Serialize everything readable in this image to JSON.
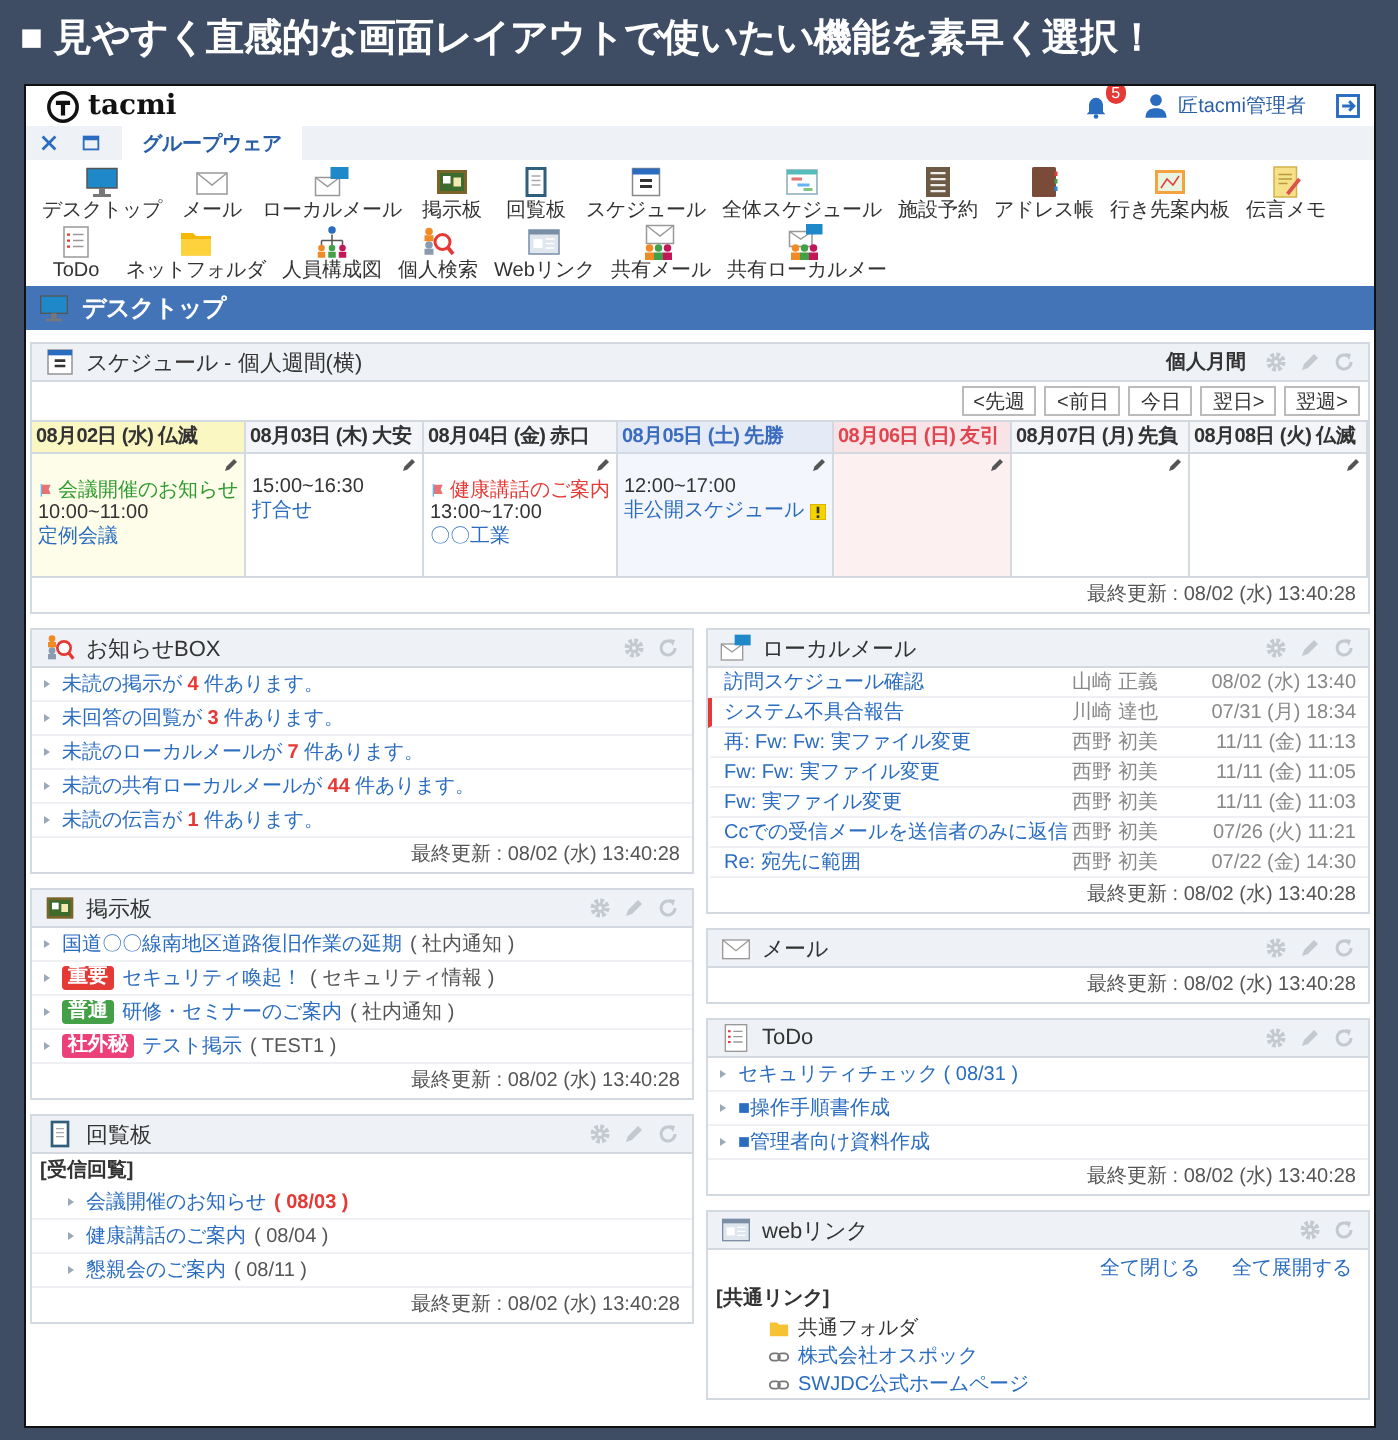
{
  "banner": {
    "title": "■ 見やすく直感的な画面レイアウトで使いたい機能を素早く選択！"
  },
  "header": {
    "logo": "tacmi",
    "notifications": "5",
    "user": "匠tacmi管理者"
  },
  "tabs": [
    {
      "label": "グループウェア",
      "selected": true
    }
  ],
  "apps": [
    {
      "label": "デスクトップ",
      "kind": "monitor"
    },
    {
      "label": "メール",
      "kind": "mail"
    },
    {
      "label": "ローカルメール",
      "kind": "localmail"
    },
    {
      "label": "掲示板",
      "kind": "board"
    },
    {
      "label": "回覧板",
      "kind": "circular"
    },
    {
      "label": "スケジュール",
      "kind": "calendar"
    },
    {
      "label": "全体スケジュール",
      "kind": "gantt"
    },
    {
      "label": "施設予約",
      "kind": "facility"
    },
    {
      "label": "アドレス帳",
      "kind": "address"
    },
    {
      "label": "行き先案内板",
      "kind": "whereabouts"
    },
    {
      "label": "伝言メモ",
      "kind": "memo"
    },
    {
      "label": "ToDo",
      "kind": "todo"
    },
    {
      "label": "ネットフォルダ",
      "kind": "folder"
    },
    {
      "label": "人員構成図",
      "kind": "org"
    },
    {
      "label": "個人検索",
      "kind": "search"
    },
    {
      "label": "Webリンク",
      "kind": "weblink"
    },
    {
      "label": "共有メール",
      "kind": "sharedmail"
    },
    {
      "label": "共有ローカルメー",
      "kind": "sharedlocal"
    }
  ],
  "page_title": "デスクトップ",
  "schedule": {
    "title": "スケジュール - 個人週間(横)",
    "view_link": "個人月間",
    "nav": [
      "<先週",
      "<前日",
      "今日",
      "翌日>",
      "翌週>"
    ],
    "days": [
      {
        "label": "08月02日 (水) 仏滅",
        "kind": "today",
        "events": [
          {
            "kind": "notice",
            "title": "会議開催のお知らせ",
            "color": "#2e9b2e"
          },
          {
            "kind": "timed",
            "time": "10:00~11:00",
            "title": "定例会議"
          }
        ]
      },
      {
        "label": "08月03日 (木) 大安",
        "kind": "weekday",
        "events": [
          {
            "kind": "timed",
            "time": "15:00~16:30",
            "title": "打合せ"
          }
        ]
      },
      {
        "label": "08月04日 (金) 赤口",
        "kind": "weekday",
        "events": [
          {
            "kind": "notice",
            "title": "健康講話のご案内",
            "color": "#e53935"
          },
          {
            "kind": "timed",
            "time": "13:00~17:00",
            "title": "〇〇工業"
          }
        ]
      },
      {
        "label": "08月05日 (土) 先勝",
        "kind": "saturday",
        "events": [
          {
            "kind": "timed",
            "time": "12:00~17:00",
            "title": "非公開スケジュール",
            "private": true
          }
        ]
      },
      {
        "label": "08月06日 (日) 友引",
        "kind": "sunday"
      },
      {
        "label": "08月07日 (月) 先負",
        "kind": "weekday"
      },
      {
        "label": "08月08日 (火) 仏滅",
        "kind": "weekday"
      }
    ],
    "updated": "最終更新 : 08/02 (水) 13:40:28"
  },
  "left_column": [
    {
      "kind": "notices",
      "title": "お知らせBOX",
      "editable": false,
      "items": [
        "未読の掲示が **4** 件あります。",
        "未回答の回覧が **3** 件あります。",
        "未読のローカルメールが **7** 件あります。",
        "未読の共有ローカルメールが **44** 件あります。",
        "未読の伝言が **1** 件あります。"
      ],
      "updated": "最終更新 : 08/02 (水) 13:40:28"
    },
    {
      "kind": "bulletin",
      "title": "掲示板",
      "editable": true,
      "items": [
        {
          "title": "国道〇〇線南地区道路復旧作業の延期",
          "category": "( 社内通知 )"
        },
        {
          "tag": {
            "label": "重要",
            "color": "#e53935"
          },
          "title": "セキュリティ喚起！",
          "category": "( セキュリティ情報 )"
        },
        {
          "tag": {
            "label": "普通",
            "color": "#43a047"
          },
          "title": "研修・セミナーのご案内",
          "category": "( 社内通知 )"
        },
        {
          "tag": {
            "label": "社外秘",
            "color": "#ec407a"
          },
          "title": "テスト掲示",
          "category": "( TEST1 )"
        }
      ],
      "updated": "最終更新 : 08/02 (水) 13:40:28"
    },
    {
      "kind": "circular",
      "title": "回覧板",
      "editable": true,
      "section": "[受信回覧]",
      "items": [
        {
          "title": "会議開催のお知らせ",
          "date": "( 08/03 )",
          "overdue": true
        },
        {
          "title": "健康講話のご案内",
          "date": "( 08/04 )",
          "overdue": false
        },
        {
          "title": "懇親会のご案内",
          "date": "( 08/11 )",
          "overdue": false
        }
      ],
      "updated": "最終更新 : 08/02 (水) 13:40:28"
    }
  ],
  "right_column": [
    {
      "kind": "localmail",
      "title": "ローカルメール",
      "editable": true,
      "rows": [
        {
          "subject": "訪問スケジュール確認",
          "sender": "山崎 正義",
          "date": "08/02 (水) 13:40",
          "flagged": false
        },
        {
          "subject": "システム不具合報告",
          "sender": "川崎 達也",
          "date": "07/31 (月) 18:34",
          "flagged": true
        },
        {
          "subject": "再: Fw: Fw: 実ファイル変更",
          "sender": "西野 初美",
          "date": "11/11 (金) 11:13",
          "flagged": false
        },
        {
          "subject": "Fw: Fw: 実ファイル変更",
          "sender": "西野 初美",
          "date": "11/11 (金) 11:05",
          "flagged": false
        },
        {
          "subject": "Fw: 実ファイル変更",
          "sender": "西野 初美",
          "date": "11/11 (金) 11:03",
          "flagged": false
        },
        {
          "subject": "Ccでの受信メールを送信者のみに返信",
          "sender": "西野 初美",
          "date": "07/26 (火) 11:21",
          "flagged": false
        },
        {
          "subject": "Re: 宛先に範囲",
          "sender": "西野 初美",
          "date": "07/22 (金) 14:30",
          "flagged": false
        }
      ],
      "updated": "最終更新 : 08/02 (水) 13:40:28"
    },
    {
      "kind": "mail",
      "title": "メール",
      "editable": true,
      "updated": "最終更新 : 08/02 (水) 13:40:28"
    },
    {
      "kind": "todo",
      "title": "ToDo",
      "editable": true,
      "items": [
        "セキュリティチェック ( 08/31 )",
        "■操作手順書作成",
        "■管理者向け資料作成"
      ],
      "updated": "最終更新 : 08/02 (水) 13:40:28"
    },
    {
      "kind": "weblinks",
      "title": "webリンク",
      "editable": false,
      "actions": [
        "全て閉じる",
        "全て展開する"
      ],
      "section": "[共通リンク]",
      "items": [
        {
          "kind": "folder",
          "label": "共通フォルダ"
        },
        {
          "kind": "link",
          "label": "株式会社オスポック"
        },
        {
          "kind": "link",
          "label": "SWJDC公式ホームページ"
        }
      ]
    }
  ]
}
